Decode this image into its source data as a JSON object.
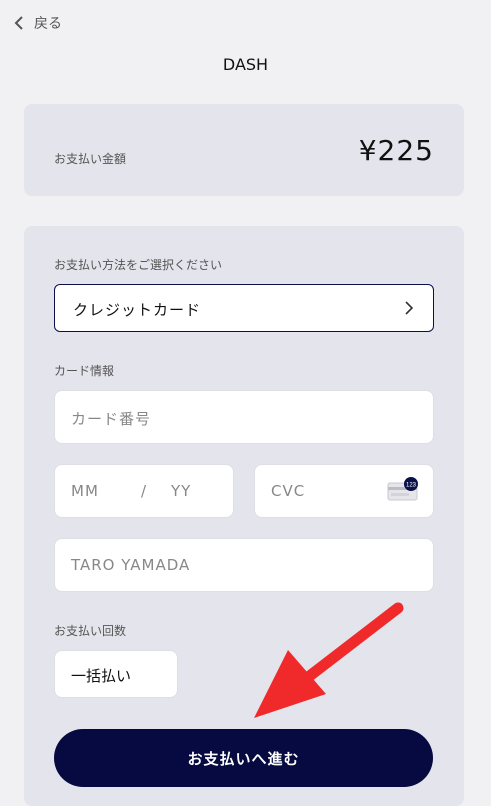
{
  "header": {
    "back_label": "戻る",
    "title": "DASH"
  },
  "amount": {
    "label": "お支払い金額",
    "value": "¥225"
  },
  "payment_method": {
    "section_label": "お支払い方法をご選択ください",
    "selected": "クレジットカード"
  },
  "card_info": {
    "section_label": "カード情報",
    "card_number_placeholder": "カード番号",
    "month_placeholder": "MM",
    "separator": "/",
    "year_placeholder": "YY",
    "cvc_placeholder": "CVC",
    "cvc_icon_text": "123",
    "name_placeholder": "TARO YAMADA"
  },
  "installments": {
    "section_label": "お支払い回数",
    "selected": "一括払い"
  },
  "submit": {
    "label": "お支払いへ進む"
  },
  "colors": {
    "navy": "#070a40",
    "annotation_arrow": "#f02a2a"
  }
}
